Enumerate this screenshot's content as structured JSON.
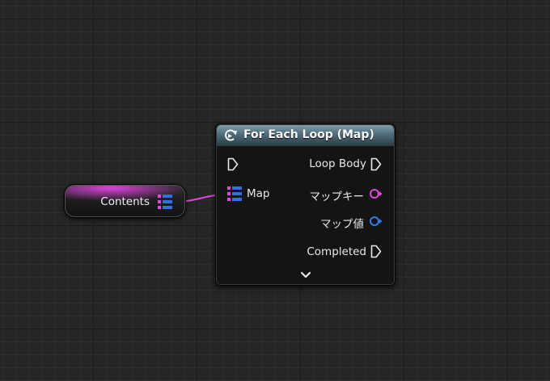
{
  "graph": {
    "variable_node": {
      "label": "Contents",
      "pin_type": "map",
      "color": "#e844e8"
    },
    "loop_node": {
      "title": "For Each Loop (Map)",
      "header_color": "#5f7e8d",
      "inputs": [
        {
          "id": "exec",
          "label": "",
          "type": "exec"
        },
        {
          "id": "map",
          "label": "Map",
          "type": "map"
        }
      ],
      "outputs": [
        {
          "id": "loop_body",
          "label": "Loop Body",
          "type": "exec"
        },
        {
          "id": "map_key",
          "label": "マップキー",
          "type": "data",
          "color": "#e844e8"
        },
        {
          "id": "map_value",
          "label": "マップ値",
          "type": "data",
          "color": "#2f7fe8"
        },
        {
          "id": "completed",
          "label": "Completed",
          "type": "exec"
        }
      ],
      "expand_icon": "chevron-down-icon"
    },
    "wire_color": "#e844e8"
  }
}
